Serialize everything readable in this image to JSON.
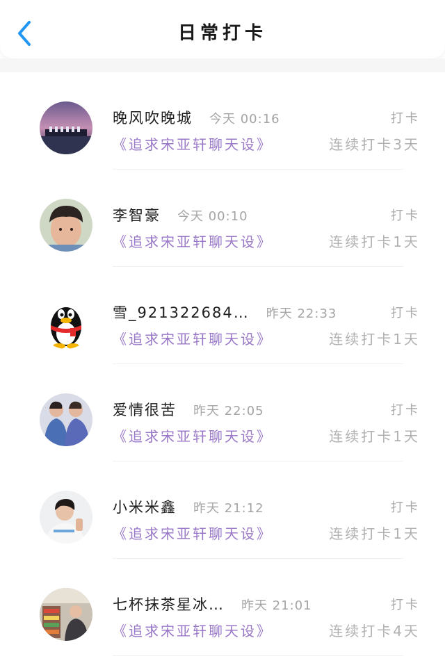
{
  "header": {
    "title": "日常打卡",
    "back_icon": "chevron-left-icon",
    "accent": "#2196f3"
  },
  "items": [
    {
      "name": "晚风吹晚城",
      "time": "今天 00:16",
      "action": "打卡",
      "topic": "《追求宋亚轩聊天设》",
      "streak": "连续打卡3天",
      "avatar": "concert-stage-avatar"
    },
    {
      "name": "李智豪",
      "time": "今天 00:10",
      "action": "打卡",
      "topic": "《追求宋亚轩聊天设》",
      "streak": "连续打卡1天",
      "avatar": "boy-photo-avatar"
    },
    {
      "name": "雪_921322684…",
      "time": "昨天 22:33",
      "action": "打卡",
      "topic": "《追求宋亚轩聊天设》",
      "streak": "连续打卡1天",
      "avatar": "qq-penguin-avatar"
    },
    {
      "name": "爱情很苦",
      "time": "昨天 22:05",
      "action": "打卡",
      "topic": "《追求宋亚轩聊天设》",
      "streak": "连续打卡1天",
      "avatar": "two-people-avatar"
    },
    {
      "name": "小米米鑫",
      "time": "昨天 21:12",
      "action": "打卡",
      "topic": "《追求宋亚轩聊天设》",
      "streak": "连续打卡1天",
      "avatar": "person-photo-avatar"
    },
    {
      "name": "七杯抹茶星冰…",
      "time": "昨天 21:01",
      "action": "打卡",
      "topic": "《追求宋亚轩聊天设》",
      "streak": "连续打卡4天",
      "avatar": "store-photo-avatar"
    }
  ]
}
